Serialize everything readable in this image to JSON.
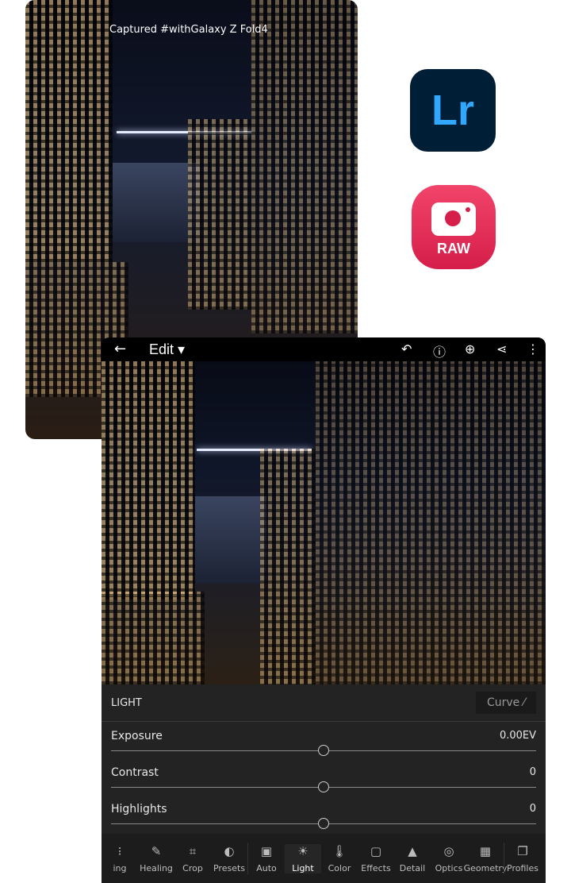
{
  "caption": "Captured #withGalaxy Z Fold4",
  "apps": {
    "lightroom": "Lr",
    "raw": "RAW"
  },
  "editor": {
    "title": "Edit",
    "icons": [
      "back-arrow-icon",
      "undo-icon",
      "help-icon",
      "add-icon",
      "share-icon",
      "more-icon"
    ],
    "panel": {
      "title": "LIGHT",
      "curve_label": "Curve",
      "sliders": [
        {
          "name": "Exposure",
          "value": "0.00EV",
          "position": 0.5
        },
        {
          "name": "Contrast",
          "value": "0",
          "position": 0.5
        },
        {
          "name": "Highlights",
          "value": "0",
          "position": 0.5
        }
      ]
    },
    "tools": [
      {
        "label": "ing",
        "glyph": "⁝"
      },
      {
        "label": "Healing",
        "glyph": "✎"
      },
      {
        "label": "Crop",
        "glyph": "⌗"
      },
      {
        "label": "Presets",
        "glyph": "◐"
      },
      {
        "label": "Auto",
        "glyph": "▣"
      },
      {
        "label": "Light",
        "glyph": "☀"
      },
      {
        "label": "Color",
        "glyph": "🌡"
      },
      {
        "label": "Effects",
        "glyph": "▢"
      },
      {
        "label": "Detail",
        "glyph": "▲"
      },
      {
        "label": "Optics",
        "glyph": "◎"
      },
      {
        "label": "Geometry",
        "glyph": "▦"
      },
      {
        "label": "Profiles",
        "glyph": "❐"
      }
    ],
    "active_tool": "Light"
  }
}
